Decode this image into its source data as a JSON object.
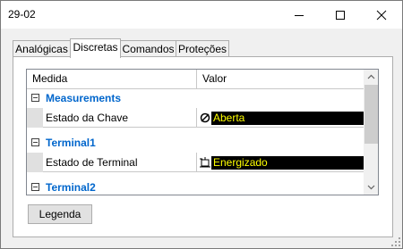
{
  "window": {
    "title": "29-02"
  },
  "tabs": [
    {
      "label": "Analógicas"
    },
    {
      "label": "Discretas"
    },
    {
      "label": "Comandos"
    },
    {
      "label": "Proteções"
    }
  ],
  "active_tab": "Discretas",
  "grid": {
    "columns": [
      "Medida",
      "Valor"
    ],
    "categories": [
      {
        "name": "Measurements",
        "rows": [
          {
            "name": "Estado da Chave",
            "value": "Aberta",
            "icon": "switch-open-icon"
          }
        ]
      },
      {
        "name": "Terminal1",
        "rows": [
          {
            "name": "Estado de Terminal",
            "value": "Energizado",
            "icon": "terminal-energized-icon"
          }
        ]
      },
      {
        "name": "Terminal2",
        "rows": []
      }
    ]
  },
  "buttons": {
    "legend": "Legenda"
  },
  "colors": {
    "category_text": "#0066cc",
    "value_bg": "#000000",
    "value_text": "#ffff00"
  }
}
